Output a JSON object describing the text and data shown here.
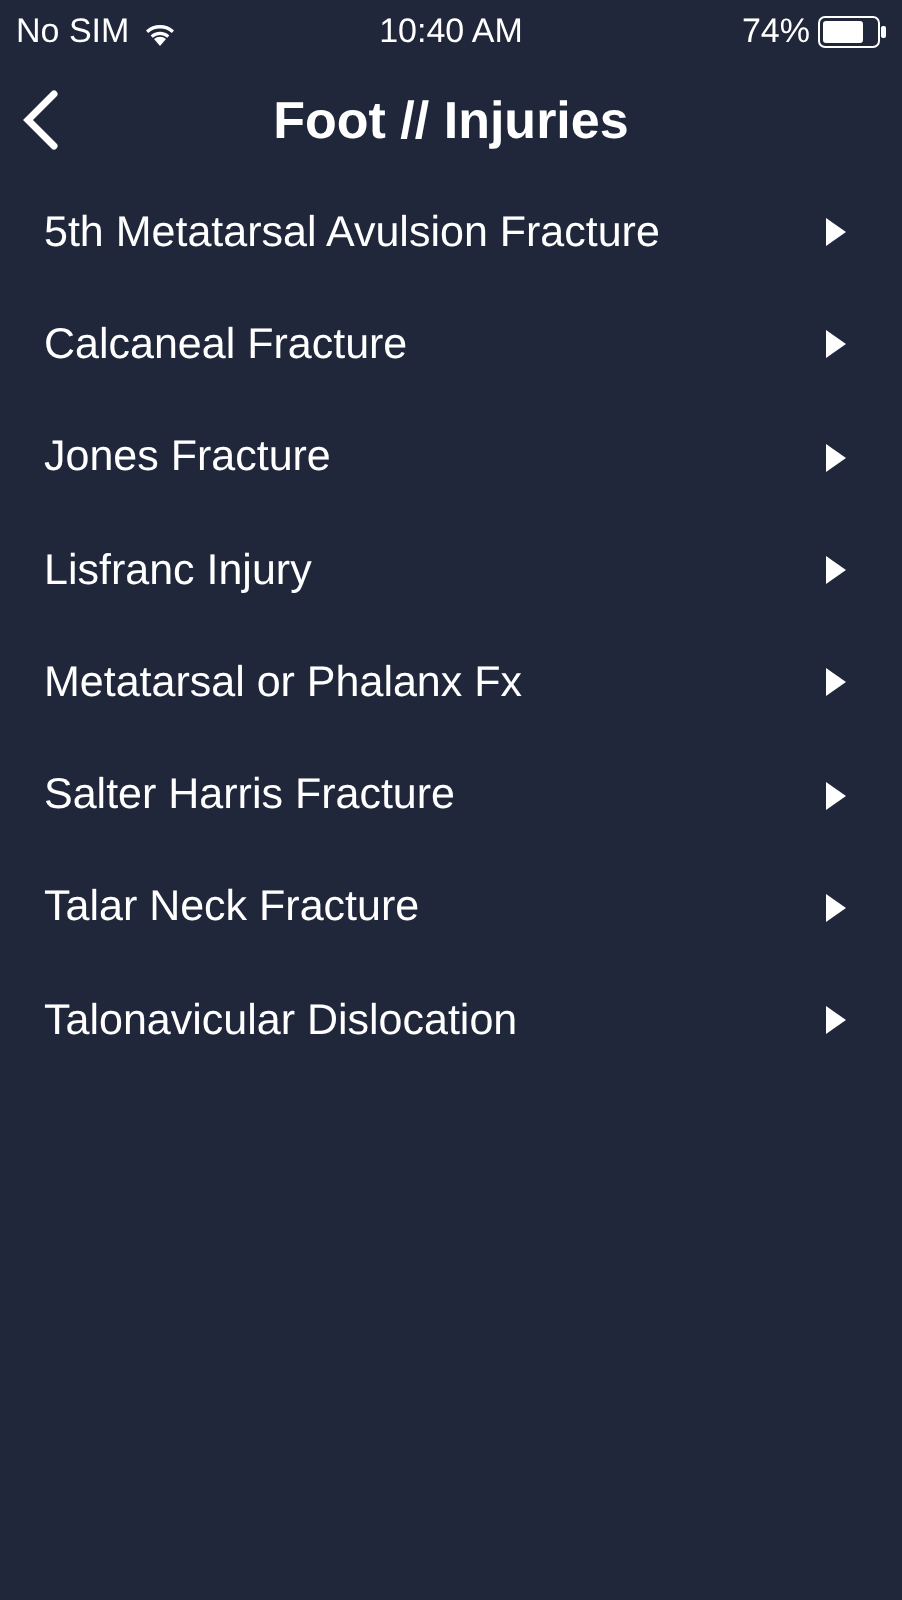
{
  "status_bar": {
    "carrier": "No SIM",
    "time": "10:40 AM",
    "battery": "74%"
  },
  "nav": {
    "title": "Foot // Injuries"
  },
  "items": [
    {
      "label": "5th Metatarsal Avulsion Fracture"
    },
    {
      "label": "Calcaneal Fracture"
    },
    {
      "label": "Jones Fracture"
    },
    {
      "label": "Lisfranc Injury"
    },
    {
      "label": "Metatarsal or Phalanx Fx"
    },
    {
      "label": "Salter Harris Fracture"
    },
    {
      "label": "Talar Neck Fracture"
    },
    {
      "label": "Talonavicular Dislocation"
    }
  ]
}
